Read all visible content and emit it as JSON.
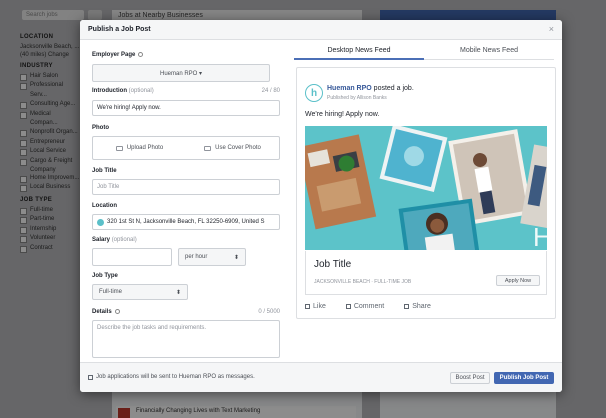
{
  "background": {
    "search_placeholder": "Search jobs",
    "header": "Jobs at Nearby Businesses",
    "location_heading": "LOCATION",
    "location_value": "Jacksonville Beach, ...",
    "location_radius": "(40 miles) Change",
    "industry_heading": "INDUSTRY",
    "industries": [
      "Hair Salon",
      "Professional Serv...",
      "Consulting Age...",
      "Medical Compan...",
      "Nonprofit Organ...",
      "Entrepreneur",
      "Local Service",
      "Cargo & Freight",
      "Company",
      "Home Improvem...",
      "Local Business"
    ],
    "job_type_heading": "JOB TYPE",
    "job_types": [
      "Full-time",
      "Part-time",
      "Internship",
      "Volunteer",
      "Contract"
    ],
    "bottom_post": "Financially Changing Lives with Text Marketing"
  },
  "modal": {
    "title": "Publish a Job Post",
    "close": "×",
    "employer_page_label": "Employer Page",
    "employer_page_value": "Hueman RPO ▾",
    "intro_label": "Introduction",
    "intro_optional": "(optional)",
    "intro_counter": "24 / 80",
    "intro_value": "We're hiring! Apply now.",
    "photo_label": "Photo",
    "upload_photo": "Upload Photo",
    "use_cover_photo": "Use Cover Photo",
    "job_title_label": "Job Title",
    "job_title_placeholder": "Job Title",
    "location_label": "Location",
    "location_value": "320 1st St N, Jacksonville Beach, FL 32250-6909, United S",
    "salary_label": "Salary",
    "salary_optional": "(optional)",
    "salary_value": "",
    "salary_period": "per hour",
    "job_type_label": "Job Type",
    "job_type_value": "Full-time",
    "details_label": "Details",
    "details_counter": "0 / 5000",
    "details_placeholder": "Describe the job tasks and requirements.",
    "footer_note": "Job applications will be sent to Hueman RPO as messages.",
    "boost_post": "Boost Post",
    "publish_job_post": "Publish Job Post"
  },
  "preview": {
    "tabs": [
      "Desktop News Feed",
      "Mobile News Feed"
    ],
    "page_name": "Hueman RPO",
    "posted_text": " posted a job.",
    "published_by": "Published by Allison Banks",
    "message": "We're hiring! Apply now.",
    "job_title": "Job Title",
    "job_meta": "JACKSONVILLE BEACH · FULL-TIME JOB",
    "apply_now": "Apply Now",
    "like": "Like",
    "comment": "Comment",
    "share": "Share"
  },
  "colors": {
    "accent": "#4267b2",
    "brand_teal": "#5cc3c9"
  }
}
